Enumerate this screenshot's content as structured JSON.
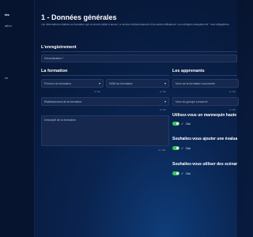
{
  "sidebar": {
    "items": [
      {
        "label": "tés",
        "active": true
      },
      {
        "label": "ation",
        "active": false
      },
      {
        "label": "es",
        "active": false
      },
      {
        "label": "",
        "active": false
      }
    ]
  },
  "page": {
    "title": "1 - Données générales",
    "intro": "Les informations relatives au formateur qui ne seront visible à aucun. Le service médical associé et les autres utilisateurs. Les rubriques marquées de * sont obligatoires."
  },
  "registration": {
    "title": "L'enregistrement",
    "name_label": "Dénomination *"
  },
  "training": {
    "title": "La formation",
    "trainer_firstname": {
      "label": "Prénom du formateur",
      "counter": "0 / 50"
    },
    "trainer_lastname": {
      "label": "NOM du formateur",
      "counter": "0 / 50"
    },
    "institution": {
      "label": "Établissement de la formation",
      "counter": "0 / 50"
    },
    "description": {
      "label": "Descriptif de la formation",
      "counter": "0 / 150"
    }
  },
  "learners": {
    "title": "Les apprenants",
    "training_name": {
      "label": "Nom de la formation concernée",
      "counter": "0 / 50"
    },
    "group_name": {
      "label": "Nom du groupe concerné",
      "counter": "0 / 50"
    },
    "questions": [
      {
        "label": "Utilisez-vous un mannequin haute",
        "toggle": "Oui"
      },
      {
        "label": "Souhaitez-vous ajouter une évalua",
        "toggle": "Oui"
      },
      {
        "label": "Souhaitez-vous utiliser des scénar",
        "toggle": "Oui"
      }
    ]
  },
  "colors": {
    "toggle_on": "#3ec264",
    "background": "#081a3c"
  },
  "icons": {
    "toggle_check": "check-icon",
    "select": "chevron-down-icon"
  }
}
